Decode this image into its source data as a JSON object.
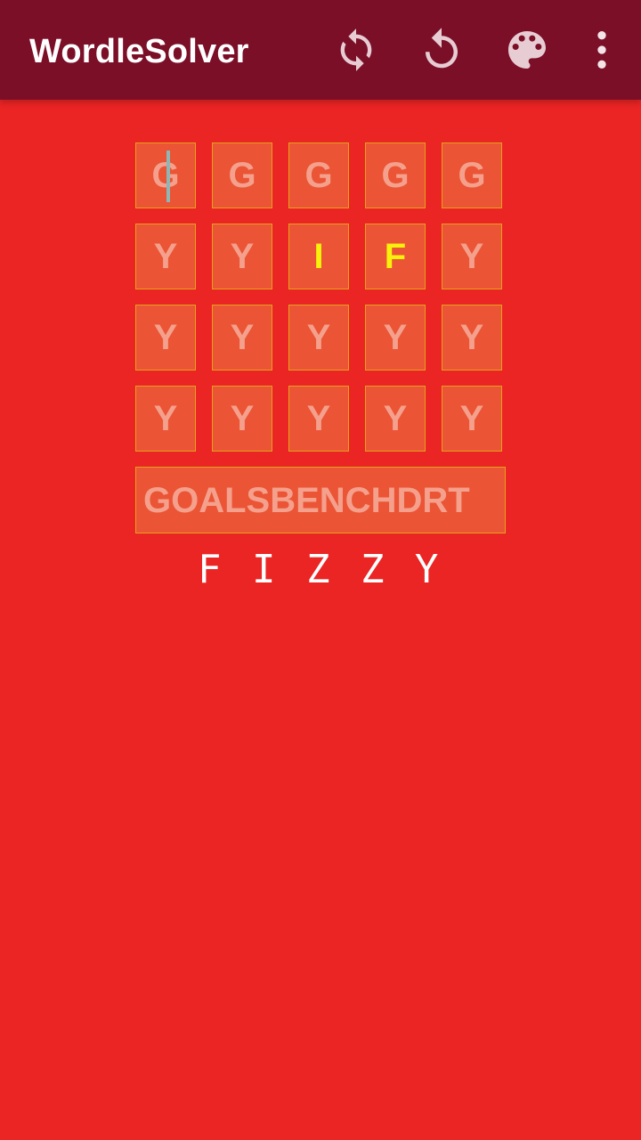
{
  "app": {
    "title": "WordleSolver"
  },
  "toolbar": {
    "actions": [
      {
        "icon": "refresh-icon",
        "label": "Refresh"
      },
      {
        "icon": "undo-icon",
        "label": "Undo"
      },
      {
        "icon": "palette-icon",
        "label": "Theme"
      },
      {
        "icon": "more-vert-icon",
        "label": "More options"
      }
    ]
  },
  "grid": {
    "rows": [
      {
        "cells": [
          "G",
          "G",
          "G",
          "G",
          "G"
        ]
      },
      {
        "cells": [
          "Y",
          "Y",
          "I",
          "F",
          "Y"
        ]
      },
      {
        "cells": [
          "Y",
          "Y",
          "Y",
          "Y",
          "Y"
        ]
      },
      {
        "cells": [
          "Y",
          "Y",
          "Y",
          "Y",
          "Y"
        ]
      }
    ]
  },
  "excluded_letters": {
    "value": "GOALSBENCHDRT"
  },
  "answer": {
    "text": "F I Z Z Y"
  },
  "colors": {
    "app_bar": "#7B0F28",
    "background": "#EB2424",
    "cell_fill": "#EB5434",
    "cell_border": "#E6A21B",
    "hint_text": "#F4A08C",
    "active_text": "#F7F20C",
    "answer_text": "#FFFFFF"
  }
}
